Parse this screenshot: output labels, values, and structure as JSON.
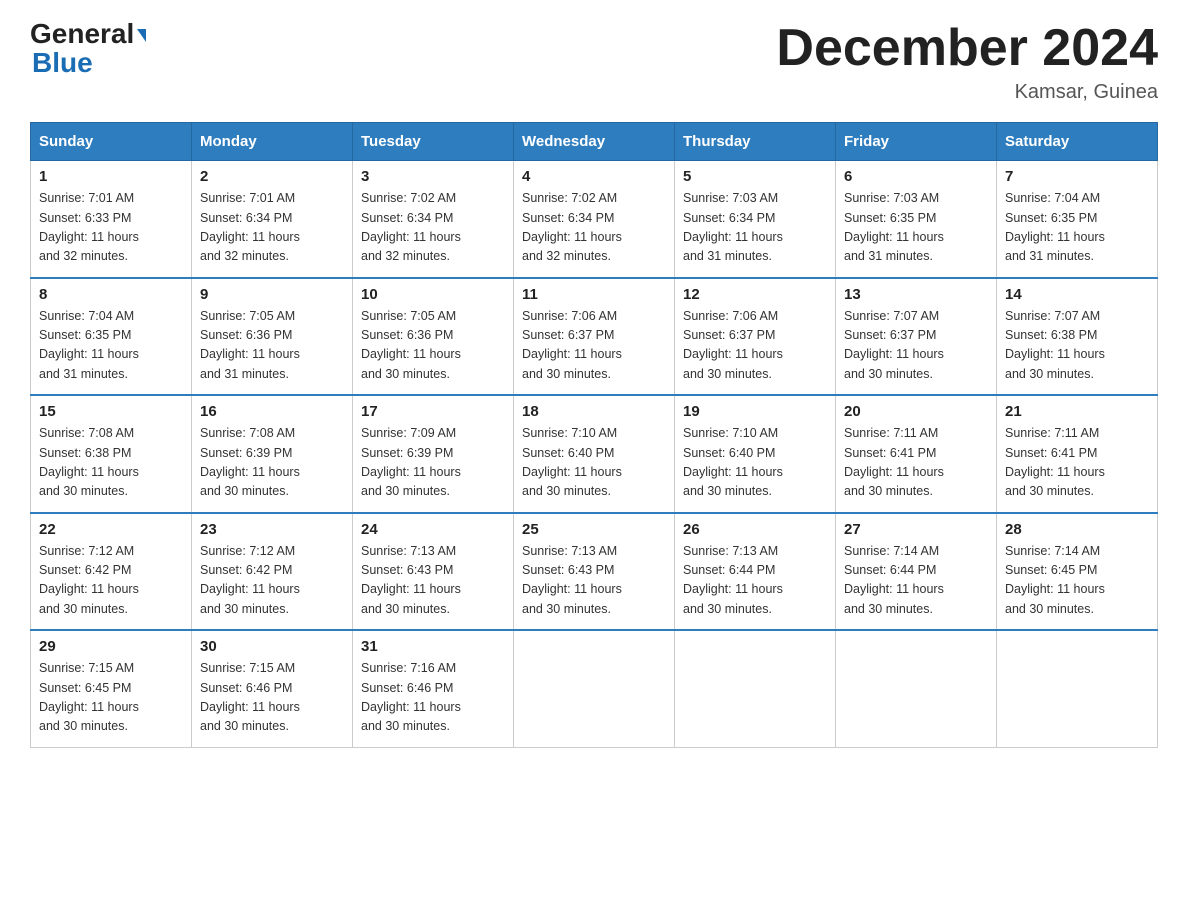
{
  "logo": {
    "general": "General",
    "blue": "Blue"
  },
  "header": {
    "title": "December 2024",
    "subtitle": "Kamsar, Guinea"
  },
  "weekdays": [
    "Sunday",
    "Monday",
    "Tuesday",
    "Wednesday",
    "Thursday",
    "Friday",
    "Saturday"
  ],
  "weeks": [
    [
      {
        "day": "1",
        "sunrise": "7:01 AM",
        "sunset": "6:33 PM",
        "daylight": "11 hours and 32 minutes."
      },
      {
        "day": "2",
        "sunrise": "7:01 AM",
        "sunset": "6:34 PM",
        "daylight": "11 hours and 32 minutes."
      },
      {
        "day": "3",
        "sunrise": "7:02 AM",
        "sunset": "6:34 PM",
        "daylight": "11 hours and 32 minutes."
      },
      {
        "day": "4",
        "sunrise": "7:02 AM",
        "sunset": "6:34 PM",
        "daylight": "11 hours and 32 minutes."
      },
      {
        "day": "5",
        "sunrise": "7:03 AM",
        "sunset": "6:34 PM",
        "daylight": "11 hours and 31 minutes."
      },
      {
        "day": "6",
        "sunrise": "7:03 AM",
        "sunset": "6:35 PM",
        "daylight": "11 hours and 31 minutes."
      },
      {
        "day": "7",
        "sunrise": "7:04 AM",
        "sunset": "6:35 PM",
        "daylight": "11 hours and 31 minutes."
      }
    ],
    [
      {
        "day": "8",
        "sunrise": "7:04 AM",
        "sunset": "6:35 PM",
        "daylight": "11 hours and 31 minutes."
      },
      {
        "day": "9",
        "sunrise": "7:05 AM",
        "sunset": "6:36 PM",
        "daylight": "11 hours and 31 minutes."
      },
      {
        "day": "10",
        "sunrise": "7:05 AM",
        "sunset": "6:36 PM",
        "daylight": "11 hours and 30 minutes."
      },
      {
        "day": "11",
        "sunrise": "7:06 AM",
        "sunset": "6:37 PM",
        "daylight": "11 hours and 30 minutes."
      },
      {
        "day": "12",
        "sunrise": "7:06 AM",
        "sunset": "6:37 PM",
        "daylight": "11 hours and 30 minutes."
      },
      {
        "day": "13",
        "sunrise": "7:07 AM",
        "sunset": "6:37 PM",
        "daylight": "11 hours and 30 minutes."
      },
      {
        "day": "14",
        "sunrise": "7:07 AM",
        "sunset": "6:38 PM",
        "daylight": "11 hours and 30 minutes."
      }
    ],
    [
      {
        "day": "15",
        "sunrise": "7:08 AM",
        "sunset": "6:38 PM",
        "daylight": "11 hours and 30 minutes."
      },
      {
        "day": "16",
        "sunrise": "7:08 AM",
        "sunset": "6:39 PM",
        "daylight": "11 hours and 30 minutes."
      },
      {
        "day": "17",
        "sunrise": "7:09 AM",
        "sunset": "6:39 PM",
        "daylight": "11 hours and 30 minutes."
      },
      {
        "day": "18",
        "sunrise": "7:10 AM",
        "sunset": "6:40 PM",
        "daylight": "11 hours and 30 minutes."
      },
      {
        "day": "19",
        "sunrise": "7:10 AM",
        "sunset": "6:40 PM",
        "daylight": "11 hours and 30 minutes."
      },
      {
        "day": "20",
        "sunrise": "7:11 AM",
        "sunset": "6:41 PM",
        "daylight": "11 hours and 30 minutes."
      },
      {
        "day": "21",
        "sunrise": "7:11 AM",
        "sunset": "6:41 PM",
        "daylight": "11 hours and 30 minutes."
      }
    ],
    [
      {
        "day": "22",
        "sunrise": "7:12 AM",
        "sunset": "6:42 PM",
        "daylight": "11 hours and 30 minutes."
      },
      {
        "day": "23",
        "sunrise": "7:12 AM",
        "sunset": "6:42 PM",
        "daylight": "11 hours and 30 minutes."
      },
      {
        "day": "24",
        "sunrise": "7:13 AM",
        "sunset": "6:43 PM",
        "daylight": "11 hours and 30 minutes."
      },
      {
        "day": "25",
        "sunrise": "7:13 AM",
        "sunset": "6:43 PM",
        "daylight": "11 hours and 30 minutes."
      },
      {
        "day": "26",
        "sunrise": "7:13 AM",
        "sunset": "6:44 PM",
        "daylight": "11 hours and 30 minutes."
      },
      {
        "day": "27",
        "sunrise": "7:14 AM",
        "sunset": "6:44 PM",
        "daylight": "11 hours and 30 minutes."
      },
      {
        "day": "28",
        "sunrise": "7:14 AM",
        "sunset": "6:45 PM",
        "daylight": "11 hours and 30 minutes."
      }
    ],
    [
      {
        "day": "29",
        "sunrise": "7:15 AM",
        "sunset": "6:45 PM",
        "daylight": "11 hours and 30 minutes."
      },
      {
        "day": "30",
        "sunrise": "7:15 AM",
        "sunset": "6:46 PM",
        "daylight": "11 hours and 30 minutes."
      },
      {
        "day": "31",
        "sunrise": "7:16 AM",
        "sunset": "6:46 PM",
        "daylight": "11 hours and 30 minutes."
      },
      null,
      null,
      null,
      null
    ]
  ],
  "labels": {
    "sunrise": "Sunrise:",
    "sunset": "Sunset:",
    "daylight": "Daylight:"
  }
}
